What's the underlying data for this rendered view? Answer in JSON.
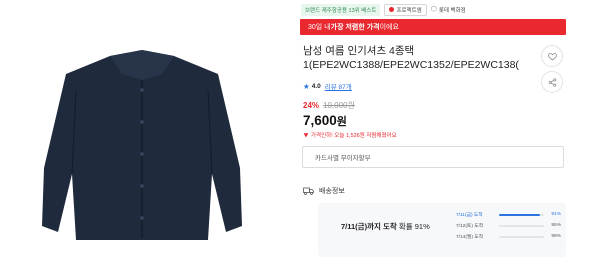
{
  "badges": {
    "green": "브랜드 제주항공용 13위 베스트",
    "outline": "프로젝트엠",
    "plain": "롯데 백화점"
  },
  "promo": {
    "prefix": "30일 내 ",
    "highlight": "가장 저렴한 가격",
    "suffix": "이에요"
  },
  "product": {
    "title_line1": "남성 여름 인기셔츠 4종택",
    "title_line2": "1(EPE2WC1388/EPE2WC1352/EPE2WC138("
  },
  "rating": {
    "score": "4.0",
    "reviews": "리뷰 87개"
  },
  "price": {
    "discount": "24%",
    "original": "10,000원",
    "current": "7,600",
    "unit": "원",
    "note": "가격인하! 오늘 1,526원 저렴해졌어요"
  },
  "card_select": {
    "label": "카드사별 무이자할부"
  },
  "delivery": {
    "heading": "배송정보",
    "main_bold": "7/11(금)까지 도착",
    "main_rest": " 확률 91%",
    "probabilities": [
      {
        "label": "7/11(금) 도착",
        "value": "91%",
        "fraction": 0.91,
        "active": true
      },
      {
        "label": "7/12(토) 도착",
        "value": "95%",
        "fraction": 0.95,
        "active": false
      },
      {
        "label": "7/14(월) 도착",
        "value": "99%",
        "fraction": 0.99,
        "active": false
      }
    ]
  },
  "colors": {
    "accent_red": "#e9282f",
    "accent_blue": "#2a73e0",
    "shirt_navy": "#1f2a3c"
  },
  "icons": {
    "wish": "heart-icon",
    "share": "share-icon",
    "truck": "truck-icon",
    "star": "star-icon"
  }
}
